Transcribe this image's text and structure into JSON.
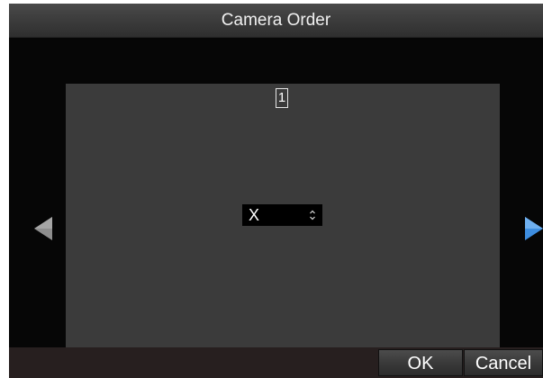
{
  "dialog": {
    "title": "Camera Order"
  },
  "content": {
    "channel_number": "1",
    "camera_select": {
      "value": "X"
    },
    "prev_arrow_icon": "arrow-left-icon",
    "next_arrow_icon": "arrow-right-icon"
  },
  "buttons": {
    "ok_label": "OK",
    "cancel_label": "Cancel"
  },
  "colors": {
    "next_arrow": "#3e8ee0",
    "prev_arrow": "#8e8e8e",
    "content_bg": "#3b3b3b",
    "dialog_bg": "#060606"
  }
}
